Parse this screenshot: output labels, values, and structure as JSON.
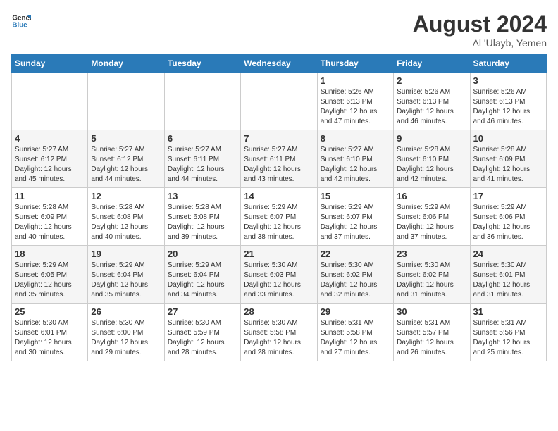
{
  "logo": {
    "line1": "General",
    "line2": "Blue"
  },
  "title": {
    "month_year": "August 2024",
    "location": "Al 'Ulayb, Yemen"
  },
  "headers": [
    "Sunday",
    "Monday",
    "Tuesday",
    "Wednesday",
    "Thursday",
    "Friday",
    "Saturday"
  ],
  "weeks": [
    [
      {
        "day": "",
        "content": ""
      },
      {
        "day": "",
        "content": ""
      },
      {
        "day": "",
        "content": ""
      },
      {
        "day": "",
        "content": ""
      },
      {
        "day": "1",
        "content": "Sunrise: 5:26 AM\nSunset: 6:13 PM\nDaylight: 12 hours\nand 47 minutes."
      },
      {
        "day": "2",
        "content": "Sunrise: 5:26 AM\nSunset: 6:13 PM\nDaylight: 12 hours\nand 46 minutes."
      },
      {
        "day": "3",
        "content": "Sunrise: 5:26 AM\nSunset: 6:13 PM\nDaylight: 12 hours\nand 46 minutes."
      }
    ],
    [
      {
        "day": "4",
        "content": "Sunrise: 5:27 AM\nSunset: 6:12 PM\nDaylight: 12 hours\nand 45 minutes."
      },
      {
        "day": "5",
        "content": "Sunrise: 5:27 AM\nSunset: 6:12 PM\nDaylight: 12 hours\nand 44 minutes."
      },
      {
        "day": "6",
        "content": "Sunrise: 5:27 AM\nSunset: 6:11 PM\nDaylight: 12 hours\nand 44 minutes."
      },
      {
        "day": "7",
        "content": "Sunrise: 5:27 AM\nSunset: 6:11 PM\nDaylight: 12 hours\nand 43 minutes."
      },
      {
        "day": "8",
        "content": "Sunrise: 5:27 AM\nSunset: 6:10 PM\nDaylight: 12 hours\nand 42 minutes."
      },
      {
        "day": "9",
        "content": "Sunrise: 5:28 AM\nSunset: 6:10 PM\nDaylight: 12 hours\nand 42 minutes."
      },
      {
        "day": "10",
        "content": "Sunrise: 5:28 AM\nSunset: 6:09 PM\nDaylight: 12 hours\nand 41 minutes."
      }
    ],
    [
      {
        "day": "11",
        "content": "Sunrise: 5:28 AM\nSunset: 6:09 PM\nDaylight: 12 hours\nand 40 minutes."
      },
      {
        "day": "12",
        "content": "Sunrise: 5:28 AM\nSunset: 6:08 PM\nDaylight: 12 hours\nand 40 minutes."
      },
      {
        "day": "13",
        "content": "Sunrise: 5:28 AM\nSunset: 6:08 PM\nDaylight: 12 hours\nand 39 minutes."
      },
      {
        "day": "14",
        "content": "Sunrise: 5:29 AM\nSunset: 6:07 PM\nDaylight: 12 hours\nand 38 minutes."
      },
      {
        "day": "15",
        "content": "Sunrise: 5:29 AM\nSunset: 6:07 PM\nDaylight: 12 hours\nand 37 minutes."
      },
      {
        "day": "16",
        "content": "Sunrise: 5:29 AM\nSunset: 6:06 PM\nDaylight: 12 hours\nand 37 minutes."
      },
      {
        "day": "17",
        "content": "Sunrise: 5:29 AM\nSunset: 6:06 PM\nDaylight: 12 hours\nand 36 minutes."
      }
    ],
    [
      {
        "day": "18",
        "content": "Sunrise: 5:29 AM\nSunset: 6:05 PM\nDaylight: 12 hours\nand 35 minutes."
      },
      {
        "day": "19",
        "content": "Sunrise: 5:29 AM\nSunset: 6:04 PM\nDaylight: 12 hours\nand 35 minutes."
      },
      {
        "day": "20",
        "content": "Sunrise: 5:29 AM\nSunset: 6:04 PM\nDaylight: 12 hours\nand 34 minutes."
      },
      {
        "day": "21",
        "content": "Sunrise: 5:30 AM\nSunset: 6:03 PM\nDaylight: 12 hours\nand 33 minutes."
      },
      {
        "day": "22",
        "content": "Sunrise: 5:30 AM\nSunset: 6:02 PM\nDaylight: 12 hours\nand 32 minutes."
      },
      {
        "day": "23",
        "content": "Sunrise: 5:30 AM\nSunset: 6:02 PM\nDaylight: 12 hours\nand 31 minutes."
      },
      {
        "day": "24",
        "content": "Sunrise: 5:30 AM\nSunset: 6:01 PM\nDaylight: 12 hours\nand 31 minutes."
      }
    ],
    [
      {
        "day": "25",
        "content": "Sunrise: 5:30 AM\nSunset: 6:01 PM\nDaylight: 12 hours\nand 30 minutes."
      },
      {
        "day": "26",
        "content": "Sunrise: 5:30 AM\nSunset: 6:00 PM\nDaylight: 12 hours\nand 29 minutes."
      },
      {
        "day": "27",
        "content": "Sunrise: 5:30 AM\nSunset: 5:59 PM\nDaylight: 12 hours\nand 28 minutes."
      },
      {
        "day": "28",
        "content": "Sunrise: 5:30 AM\nSunset: 5:58 PM\nDaylight: 12 hours\nand 28 minutes."
      },
      {
        "day": "29",
        "content": "Sunrise: 5:31 AM\nSunset: 5:58 PM\nDaylight: 12 hours\nand 27 minutes."
      },
      {
        "day": "30",
        "content": "Sunrise: 5:31 AM\nSunset: 5:57 PM\nDaylight: 12 hours\nand 26 minutes."
      },
      {
        "day": "31",
        "content": "Sunrise: 5:31 AM\nSunset: 5:56 PM\nDaylight: 12 hours\nand 25 minutes."
      }
    ]
  ]
}
